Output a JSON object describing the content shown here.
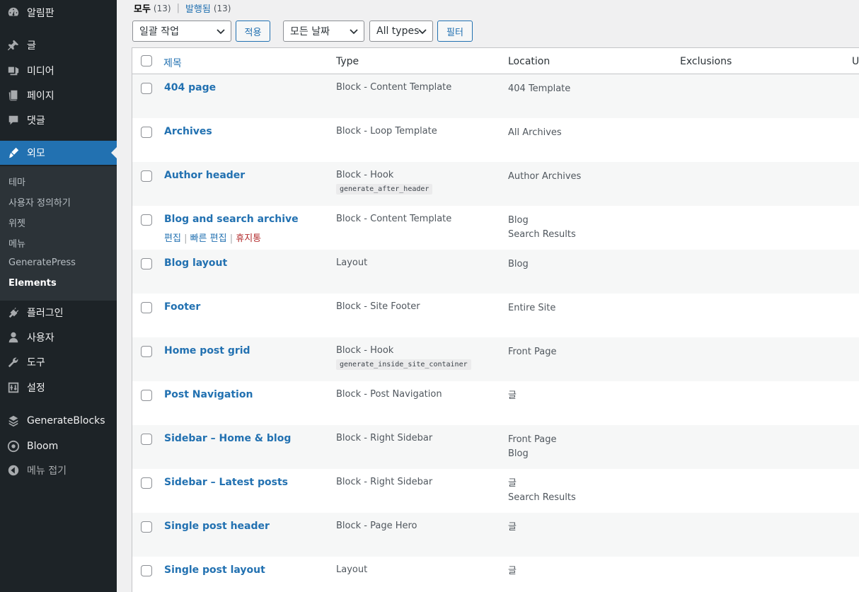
{
  "sidebar": {
    "items": [
      {
        "label": "알림판",
        "icon": "dashboard-icon"
      },
      {
        "label": "글",
        "icon": "pin-icon"
      },
      {
        "label": "미디어",
        "icon": "media-icon"
      },
      {
        "label": "페이지",
        "icon": "page-icon"
      },
      {
        "label": "댓글",
        "icon": "comment-icon"
      },
      {
        "label": "외모",
        "icon": "brush-icon",
        "active": true
      },
      {
        "label": "플러그인",
        "icon": "plugin-icon"
      },
      {
        "label": "사용자",
        "icon": "user-icon"
      },
      {
        "label": "도구",
        "icon": "wrench-icon"
      },
      {
        "label": "설정",
        "icon": "settings-icon"
      },
      {
        "label": "GenerateBlocks",
        "icon": "generateblocks-icon"
      },
      {
        "label": "Bloom",
        "icon": "bloom-icon"
      },
      {
        "label": "메뉴 접기",
        "icon": "collapse-icon"
      }
    ],
    "submenu": [
      "테마",
      "사용자 정의하기",
      "위젯",
      "메뉴",
      "GeneratePress",
      "Elements"
    ]
  },
  "views": {
    "all_label": "모두",
    "all_count": "(13)",
    "separator": "|",
    "published_label": "발행됨",
    "published_count": "(13)"
  },
  "toolbar": {
    "bulk_action": "일괄 작업",
    "apply": "적용",
    "all_dates": "모든 날짜",
    "all_types": "All types",
    "filter": "필터"
  },
  "table": {
    "columns": [
      "제목",
      "Type",
      "Location",
      "Exclusions",
      "U"
    ],
    "rows": [
      {
        "title": "404 page",
        "type": "Block - Content Template",
        "hook": "",
        "locations": [
          "404 Template"
        ]
      },
      {
        "title": "Archives",
        "type": "Block - Loop Template",
        "hook": "",
        "locations": [
          "All Archives"
        ]
      },
      {
        "title": "Author header",
        "type": "Block - Hook",
        "hook": "generate_after_header",
        "locations": [
          "Author Archives"
        ]
      },
      {
        "title": "Blog and search archive",
        "type": "Block - Content Template",
        "hook": "",
        "locations": [
          "Blog",
          "Search Results"
        ],
        "actions": true
      },
      {
        "title": "Blog layout",
        "type": "Layout",
        "hook": "",
        "locations": [
          "Blog"
        ]
      },
      {
        "title": "Footer",
        "type": "Block - Site Footer",
        "hook": "",
        "locations": [
          "Entire Site"
        ]
      },
      {
        "title": "Home post grid",
        "type": "Block - Hook",
        "hook": "generate_inside_site_container",
        "locations": [
          "Front Page"
        ]
      },
      {
        "title": "Post Navigation",
        "type": "Block - Post Navigation",
        "hook": "",
        "locations": [
          "글"
        ]
      },
      {
        "title": "Sidebar – Home & blog",
        "type": "Block - Right Sidebar",
        "hook": "",
        "locations": [
          "Front Page",
          "Blog"
        ]
      },
      {
        "title": "Sidebar – Latest posts",
        "type": "Block - Right Sidebar",
        "hook": "",
        "locations": [
          "글",
          "Search Results"
        ]
      },
      {
        "title": "Single post header",
        "type": "Block - Page Hero",
        "hook": "",
        "locations": [
          "글"
        ]
      },
      {
        "title": "Single post layout",
        "type": "Layout",
        "hook": "",
        "locations": [
          "글"
        ]
      }
    ],
    "row_actions": {
      "edit": "편집",
      "quick_edit": "빠른 편집",
      "trash": "휴지통",
      "sep": "|"
    }
  },
  "colors": {
    "sidebar_bg": "#1d2327",
    "active_bg": "#2271b1",
    "link": "#2271b1",
    "trash": "#b32d2e"
  }
}
